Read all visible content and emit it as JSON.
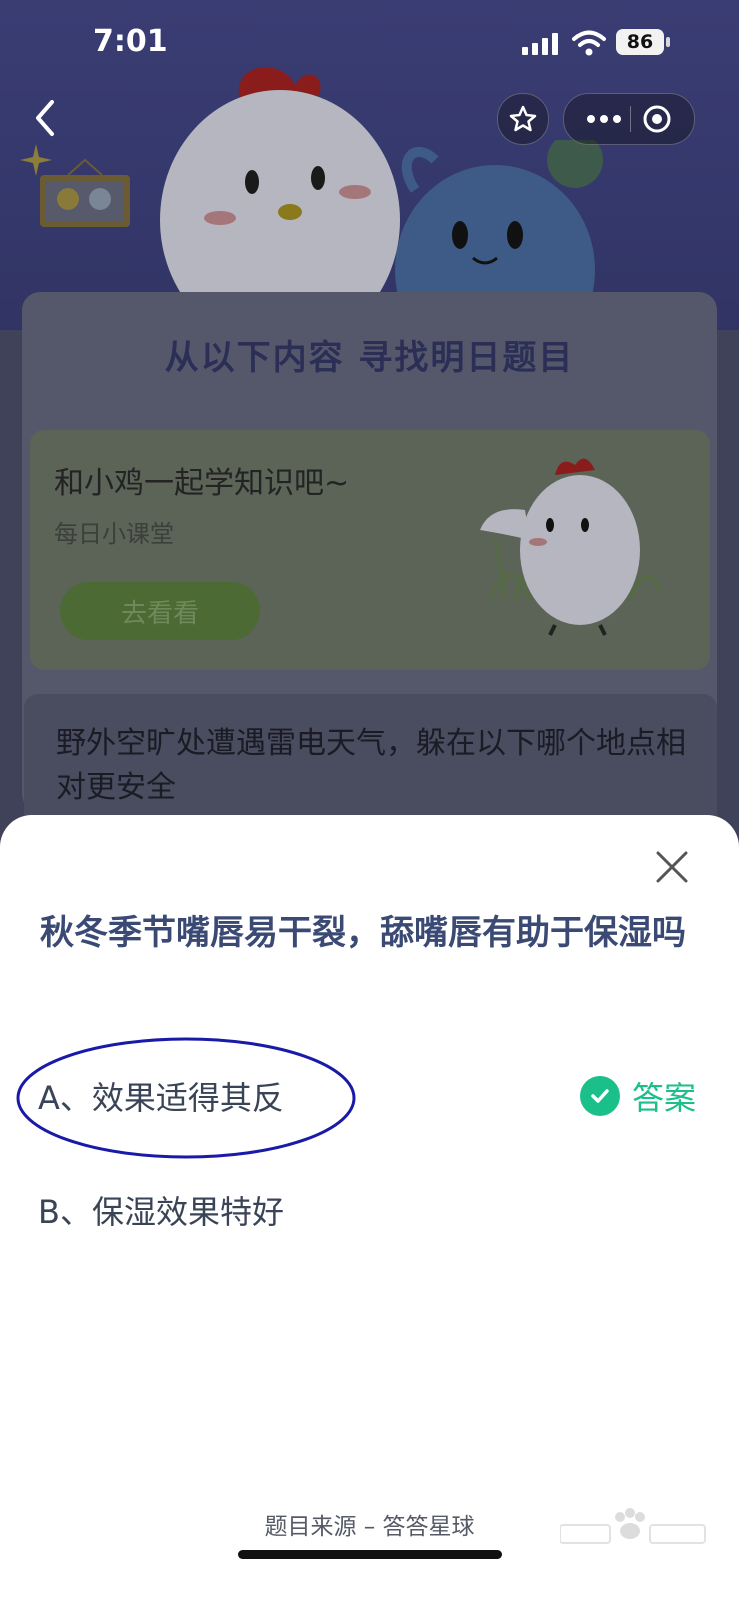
{
  "status_bar": {
    "time": "7:01",
    "battery": "86"
  },
  "background_page": {
    "section_title": "从以下内容 寻找明日题目",
    "learn_card": {
      "title": "和小鸡一起学知识吧~",
      "subtitle": "每日小课堂",
      "button": "去看看"
    },
    "quiz_card": {
      "question": "野外空旷处遭遇雷电天气，躲在以下哪个地点相对更安全"
    }
  },
  "sheet": {
    "question": "秋冬季节嘴唇易干裂，舔嘴唇有助于保湿吗",
    "options": [
      {
        "label": "A、效果适得其反",
        "is_answer": true
      },
      {
        "label": "B、保湿效果特好",
        "is_answer": false
      }
    ],
    "answer_label": "答案",
    "source": "题目来源 – 答答星球"
  },
  "colors": {
    "accent_green": "#1bbf8a",
    "question_text": "#3b4a74",
    "highlight_ellipse": "#1a1aa8"
  },
  "icons": [
    "back-icon",
    "star-icon",
    "more-icon",
    "target-icon",
    "close-icon",
    "check-icon"
  ]
}
